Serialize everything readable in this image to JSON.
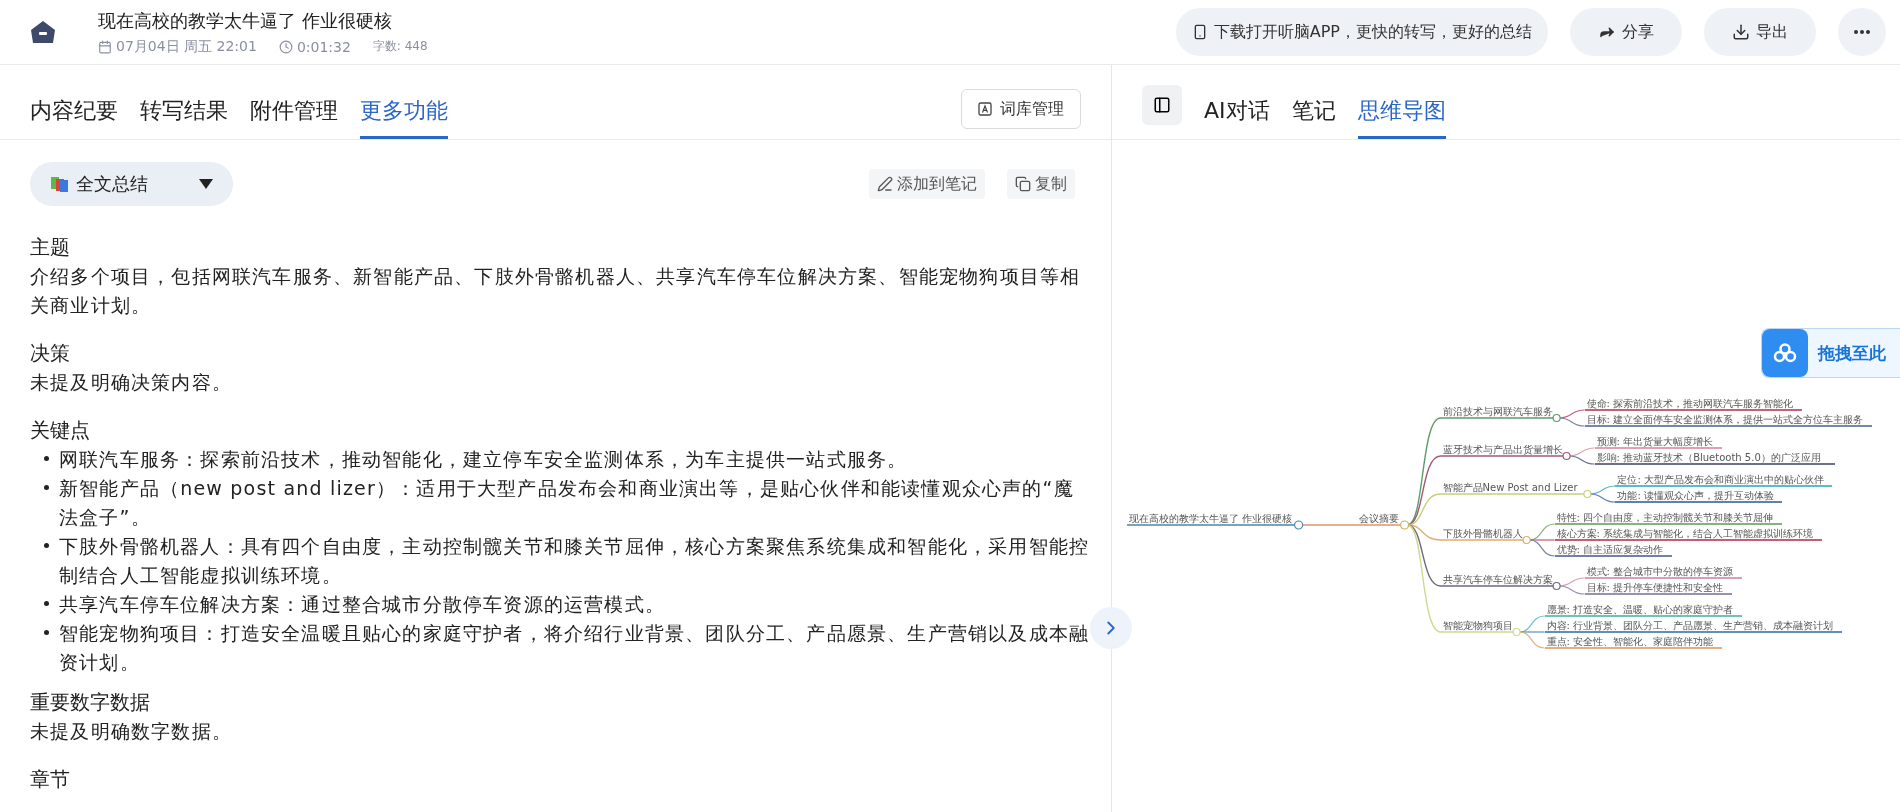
{
  "header": {
    "title": "现在高校的教学太牛逼了 作业很硬核",
    "date": "07月04日 周五 22:01",
    "duration": "0:01:32",
    "word_count": "字数: 448",
    "promo": "下载打开听脑APP，更快的转写，更好的总结",
    "actions": [
      {
        "label": "分享",
        "kind": "share"
      },
      {
        "label": "导出",
        "kind": "export"
      }
    ]
  },
  "left": {
    "tabs": [
      {
        "label": "内容纪要",
        "selected": false
      },
      {
        "label": "转写结果",
        "selected": false
      },
      {
        "label": "附件管理",
        "selected": false
      },
      {
        "label": "更多功能",
        "selected": true
      }
    ],
    "lexicon_button": "词库管理",
    "summary_select": "全文总结",
    "actions": [
      {
        "label": "添加到笔记",
        "kind": "note"
      },
      {
        "label": "复制",
        "kind": "copy"
      }
    ],
    "sections": [
      {
        "heading": "主题",
        "body": "介绍多个项目，包括网联汽车服务、新智能产品、下肢外骨骼机器人、共享汽车停车位解决方案、智能宠物狗项目等相关商业计划。"
      },
      {
        "heading": "决策",
        "body": "未提及明确决策内容。"
      },
      {
        "heading": "关键点",
        "bullets": [
          "网联汽车服务：探索前沿技术，推动智能化，建立停车安全监测体系，为车主提供一站式服务。",
          "新智能产品（new post and lizer）：适用于大型产品发布会和商业演出等，是贴心伙伴和能读懂观众心声的“魔法盒子”。",
          "下肢外骨骼机器人：具有四个自由度，主动控制髋关节和膝关节屈伸，核心方案聚焦系统集成和智能化，采用智能控制结合人工智能虚拟训练环境。",
          "共享汽车停车位解决方案：通过整合城市分散停车资源的运营模式。",
          "智能宠物狗项目：打造安全温暖且贴心的家庭守护者，将介绍行业背景、团队分工、产品愿景、生产营销以及成本融资计划。"
        ]
      },
      {
        "heading": "重要数字数据",
        "body": "未提及明确数字数据。"
      },
      {
        "heading": "章节"
      }
    ]
  },
  "right": {
    "tabs": [
      {
        "label": "AI对话",
        "selected": false
      },
      {
        "label": "笔记",
        "selected": false
      },
      {
        "label": "思维导图",
        "selected": true
      }
    ],
    "upload_hint": "拖拽至此",
    "mindmap": {
      "root": "现在高校的教学太牛逼了 作业很硬核",
      "center": "会议摘要",
      "branches": [
        {
          "label": "前沿技术与网联汽车服务",
          "color": "#5e9a6a",
          "children": [
            {
              "label": "使命: 探索前沿技术，推动网联汽车服务智能化",
              "color": "#c4607a"
            },
            {
              "label": "目标: 建立全面停车安全监测体系，提供一站式全方位车主服务",
              "color": "#7a86a8"
            }
          ]
        },
        {
          "label": "蓝牙技术与产品出货量增长",
          "color": "#a05a70",
          "children": [
            {
              "label": "预测: 年出货量大幅度增长",
              "color": "#e0a0b0"
            },
            {
              "label": "影响: 推动蓝牙技术（Bluetooth 5.0）的广泛应用",
              "color": "#6a7090"
            }
          ]
        },
        {
          "label": "智能产品New Post and Lizer",
          "color": "#c8cf7a",
          "children": [
            {
              "label": "定位: 大型产品发布会和商业演出中的贴心伙伴",
              "color": "#60b8c8"
            },
            {
              "label": "功能: 读懂观众心声，提升互动体验",
              "color": "#6080b0"
            }
          ]
        },
        {
          "label": "下肢外骨骼机器人",
          "color": "#e0b070",
          "children": [
            {
              "label": "特性: 四个自由度，主动控制髋关节和膝关节屈伸",
              "color": "#8ab080"
            },
            {
              "label": "核心方案: 系统集成与智能化，结合人工智能虚拟训练环境",
              "color": "#c06070"
            },
            {
              "label": "优势: 自主适应复杂动作",
              "color": "#7080a8"
            }
          ]
        },
        {
          "label": "共享汽车停车位解决方案",
          "color": "#706880",
          "children": [
            {
              "label": "模式: 整合城市中分散的停车资源",
              "color": "#d8a0b8"
            },
            {
              "label": "目标: 提升停车便捷性和安全性",
              "color": "#9a90b0"
            }
          ]
        },
        {
          "label": "智能宠物狗项目",
          "color": "#d0d890",
          "children": [
            {
              "label": "愿景: 打造安全、温暖、贴心的家庭守护者",
              "color": "#70c0c0"
            },
            {
              "label": "内容: 行业背景、团队分工、产品愿景、生产营销、成本融资计划",
              "color": "#6090b8"
            },
            {
              "label": "重点: 安全性、智能化、家庭陪伴功能",
              "color": "#e0b080"
            }
          ]
        }
      ]
    }
  }
}
